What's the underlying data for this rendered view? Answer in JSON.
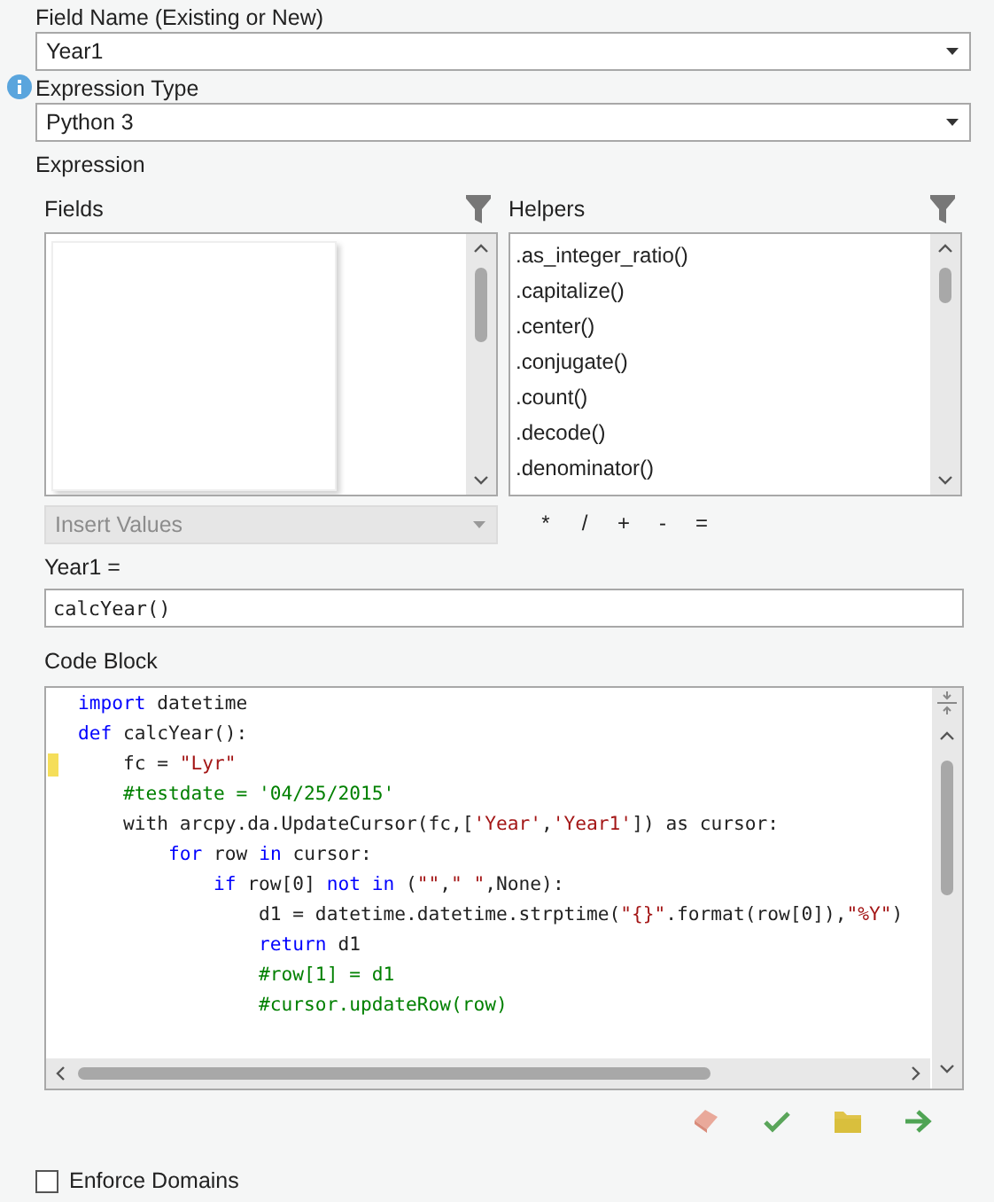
{
  "field_name": {
    "label": "Field Name (Existing or New)",
    "value": "Year1"
  },
  "expression_type": {
    "label": "Expression Type",
    "value": "Python 3"
  },
  "expression": {
    "label": "Expression"
  },
  "fields": {
    "label": "Fields"
  },
  "helpers": {
    "label": "Helpers",
    "items": [
      ".as_integer_ratio()",
      ".capitalize()",
      ".center()",
      ".conjugate()",
      ".count()",
      ".decode()",
      ".denominator()"
    ]
  },
  "insert_values": {
    "value": "Insert Values",
    "disabled": true
  },
  "operators": [
    "*",
    "/",
    "+",
    "-",
    "="
  ],
  "expression_input": {
    "label": "Year1 =",
    "value": "calcYear()"
  },
  "code_block": {
    "label": "Code Block",
    "lines": [
      {
        "marked": false,
        "tokens": [
          {
            "kind": "kw",
            "text": "import"
          },
          {
            "kind": "txt",
            "text": " datetime"
          }
        ]
      },
      {
        "marked": false,
        "tokens": [
          {
            "kind": "kw",
            "text": "def"
          },
          {
            "kind": "txt",
            "text": " calcYear():"
          }
        ]
      },
      {
        "marked": true,
        "tokens": [
          {
            "kind": "txt",
            "text": "    fc = "
          },
          {
            "kind": "str",
            "text": "\"Lyr\""
          }
        ]
      },
      {
        "marked": false,
        "tokens": [
          {
            "kind": "com",
            "text": "    #testdate = '04/25/2015'"
          }
        ]
      },
      {
        "marked": false,
        "tokens": [
          {
            "kind": "txt",
            "text": "    with arcpy.da.UpdateCursor(fc,["
          },
          {
            "kind": "str",
            "text": "'Year'"
          },
          {
            "kind": "txt",
            "text": ","
          },
          {
            "kind": "str",
            "text": "'Year1'"
          },
          {
            "kind": "txt",
            "text": "]) as cursor:"
          }
        ]
      },
      {
        "marked": false,
        "tokens": [
          {
            "kind": "kw",
            "text": "        for"
          },
          {
            "kind": "txt",
            "text": " row "
          },
          {
            "kind": "kw",
            "text": "in"
          },
          {
            "kind": "txt",
            "text": " cursor:"
          }
        ]
      },
      {
        "marked": false,
        "tokens": [
          {
            "kind": "kw",
            "text": "            if"
          },
          {
            "kind": "txt",
            "text": " row[0] "
          },
          {
            "kind": "kw",
            "text": "not in"
          },
          {
            "kind": "txt",
            "text": " ("
          },
          {
            "kind": "str",
            "text": "\"\""
          },
          {
            "kind": "txt",
            "text": ","
          },
          {
            "kind": "str",
            "text": "\" \""
          },
          {
            "kind": "txt",
            "text": ",None):"
          }
        ]
      },
      {
        "marked": false,
        "tokens": [
          {
            "kind": "txt",
            "text": "                d1 = datetime.datetime.strptime("
          },
          {
            "kind": "str",
            "text": "\"{}\""
          },
          {
            "kind": "txt",
            "text": ".format(row[0]),"
          },
          {
            "kind": "str",
            "text": "\"%Y\""
          },
          {
            "kind": "txt",
            "text": ")"
          }
        ]
      },
      {
        "marked": false,
        "tokens": [
          {
            "kind": "kw",
            "text": "                return"
          },
          {
            "kind": "txt",
            "text": " d1"
          }
        ]
      },
      {
        "marked": false,
        "tokens": [
          {
            "kind": "com",
            "text": "                #row[1] = d1"
          }
        ]
      },
      {
        "marked": false,
        "tokens": [
          {
            "kind": "com",
            "text": "                #cursor.updateRow(row)"
          }
        ]
      }
    ]
  },
  "enforce_domains": {
    "label": "Enforce Domains",
    "checked": false
  }
}
